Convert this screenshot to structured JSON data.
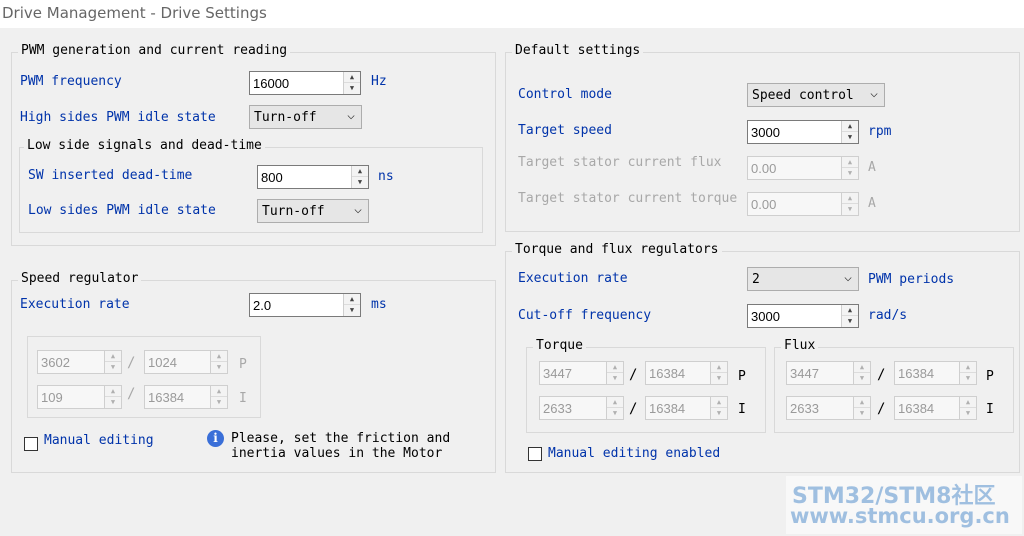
{
  "window": {
    "title": "Drive Management - Drive Settings"
  },
  "pwm": {
    "legend": "PWM generation and current reading",
    "freq_label": "PWM frequency",
    "freq_value": "16000",
    "freq_unit": "Hz",
    "high_label": "High sides PWM idle state",
    "high_value": "Turn-off",
    "low_group": {
      "legend": "Low side signals and dead-time",
      "dead_label": "SW inserted dead-time",
      "dead_value": "800",
      "dead_unit": "ns",
      "low_label": "Low sides PWM idle state",
      "low_value": "Turn-off"
    }
  },
  "speed": {
    "legend": "Speed regulator",
    "rate_label": "Execution rate",
    "rate_value": "2.0",
    "rate_unit": "ms",
    "p_num": "3602",
    "p_den": "1024",
    "p_label": "P",
    "i_num": "109",
    "i_den": "16384",
    "i_label": "I",
    "manual_label": "Manual editing",
    "info_line1": "Please, set the friction and",
    "info_line2": "inertia values in the Motor"
  },
  "defaults": {
    "legend": "Default settings",
    "mode_label": "Control mode",
    "mode_value": "Speed control",
    "speed_label": "Target speed",
    "speed_value": "3000",
    "speed_unit": "rpm",
    "flux_label": "Target stator current flux",
    "flux_value": "0.00",
    "flux_unit": "A",
    "torque_label": "Target stator current torque",
    "torque_value": "0.00",
    "torque_unit": "A"
  },
  "tf": {
    "legend": "Torque and flux regulators",
    "rate_label": "Execution rate",
    "rate_value": "2",
    "rate_unit": "PWM periods",
    "cut_label": "Cut-off frequency",
    "cut_value": "3000",
    "cut_unit": "rad/s",
    "torque": {
      "legend": "Torque",
      "p_num": "3447",
      "p_den": "16384",
      "p_label": "P",
      "i_num": "2633",
      "i_den": "16384",
      "i_label": "I"
    },
    "flux": {
      "legend": "Flux",
      "p_num": "3447",
      "p_den": "16384",
      "p_label": "P",
      "i_num": "2633",
      "i_den": "16384",
      "i_label": "I"
    },
    "manual_label": "Manual editing enabled"
  },
  "watermark": {
    "line1": "STM32/STM8社区",
    "line2": "www.stmcu.org.cn"
  }
}
